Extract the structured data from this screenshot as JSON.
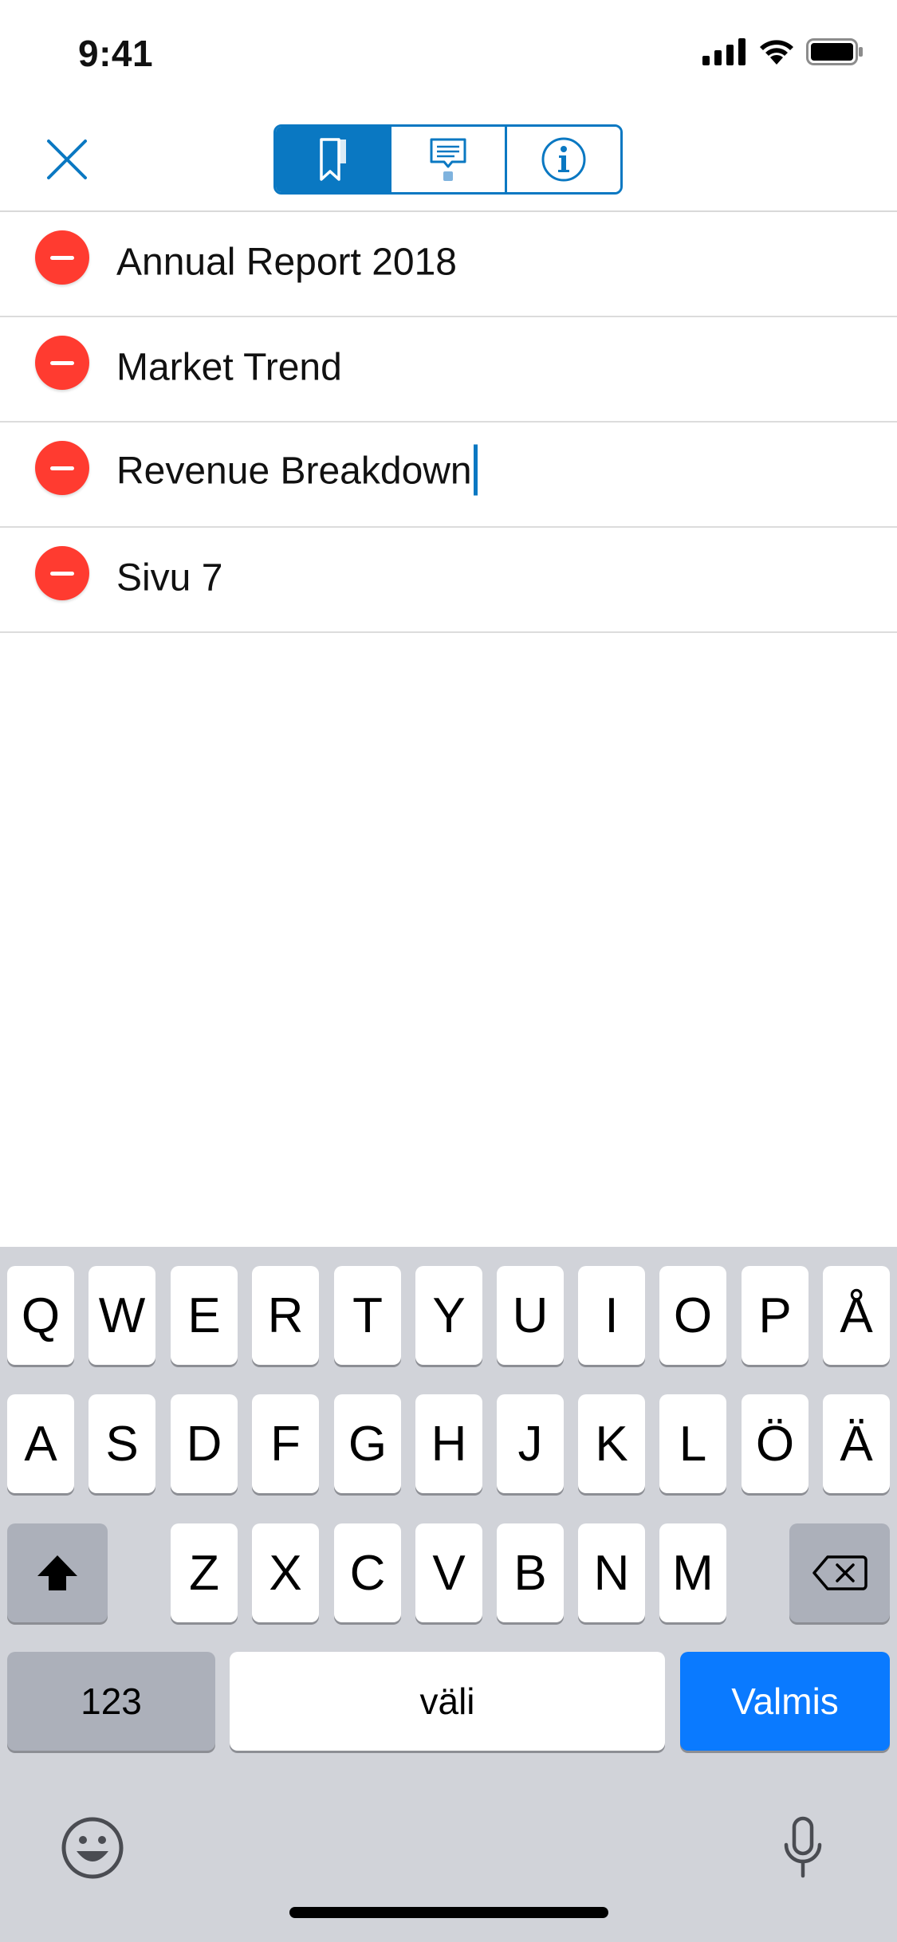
{
  "status_bar": {
    "time": "9:41",
    "icons": [
      "cellular-signal-icon",
      "wifi-icon",
      "battery-icon"
    ]
  },
  "nav_bar": {
    "close_icon": "close-icon",
    "tabs": [
      {
        "name": "bookmarks",
        "icon": "bookmark-icon",
        "active": true
      },
      {
        "name": "comments",
        "icon": "comment-icon",
        "active": false
      },
      {
        "name": "info",
        "icon": "info-icon",
        "active": false
      }
    ]
  },
  "bookmarks": [
    {
      "label": "Annual Report 2018",
      "editing": false
    },
    {
      "label": "Market Trend",
      "editing": false
    },
    {
      "label": "Revenue Breakdown",
      "editing": true
    },
    {
      "label": "Sivu 7",
      "editing": false
    }
  ],
  "keyboard": {
    "row1": [
      "Q",
      "W",
      "E",
      "R",
      "T",
      "Y",
      "U",
      "I",
      "O",
      "P",
      "Å"
    ],
    "row2": [
      "A",
      "S",
      "D",
      "F",
      "G",
      "H",
      "J",
      "K",
      "L",
      "Ö",
      "Ä"
    ],
    "row3": [
      "Z",
      "X",
      "C",
      "V",
      "B",
      "N",
      "M"
    ],
    "numbers_key": "123",
    "space_key": "väli",
    "done_key": "Valmis",
    "shift_icon": "shift-icon",
    "backspace_icon": "backspace-icon",
    "emoji_icon": "emoji-icon",
    "mic_icon": "microphone-icon"
  },
  "colors": {
    "accent": "#0a78c2",
    "delete": "#ff3b30",
    "done_key": "#0a7aff",
    "keyboard_bg": "#d1d3d9"
  }
}
